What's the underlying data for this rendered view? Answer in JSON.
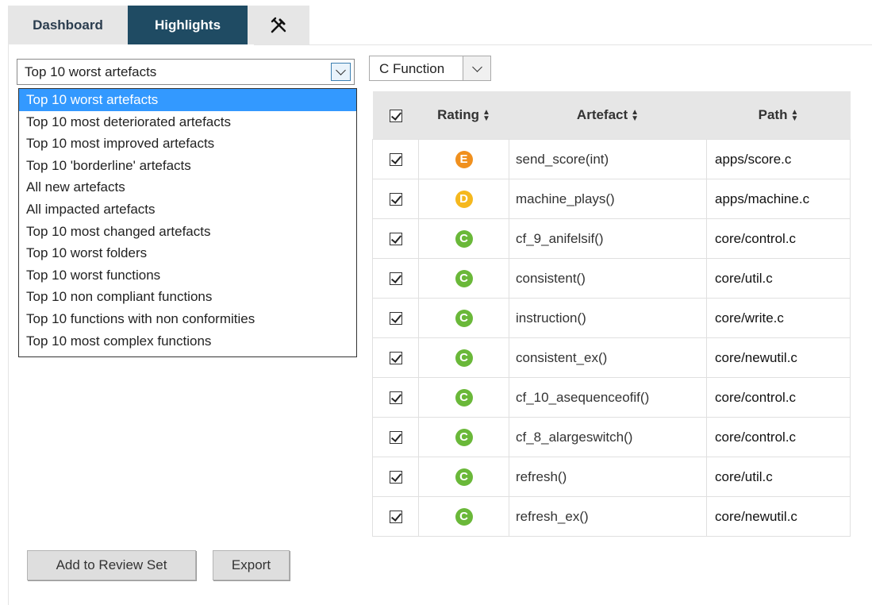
{
  "tabs": {
    "dashboard": "Dashboard",
    "highlights": "Highlights",
    "tools_icon": "✕"
  },
  "highlight_select": {
    "value": "Top 10 worst artefacts",
    "options": [
      "Top 10 worst artefacts",
      "Top 10 most deteriorated artefacts",
      "Top 10 most improved artefacts",
      "Top 10 'borderline' artefacts",
      "All new artefacts",
      "All impacted artefacts",
      "Top 10 most changed artefacts",
      "Top 10 worst folders",
      "Top 10 worst functions",
      "Top 10 non compliant functions",
      "Top 10 functions with non conformities",
      "Top 10 most complex functions"
    ],
    "selected_index": 0
  },
  "type_select": {
    "value": "C Function"
  },
  "table": {
    "headers": {
      "rating": "Rating",
      "artefact": "Artefact",
      "path": "Path"
    },
    "rows": [
      {
        "rating": "E",
        "rating_color": "#f0901e",
        "artefact": "send_score(int)",
        "path": "apps/score.c"
      },
      {
        "rating": "D",
        "rating_color": "#f5b81e",
        "artefact": "machine_plays()",
        "path": "apps/machine.c"
      },
      {
        "rating": "C",
        "rating_color": "#6ab839",
        "artefact": "cf_9_anifelsif()",
        "path": "core/control.c"
      },
      {
        "rating": "C",
        "rating_color": "#6ab839",
        "artefact": "consistent()",
        "path": "core/util.c"
      },
      {
        "rating": "C",
        "rating_color": "#6ab839",
        "artefact": "instruction()",
        "path": "core/write.c"
      },
      {
        "rating": "C",
        "rating_color": "#6ab839",
        "artefact": "consistent_ex()",
        "path": "core/newutil.c"
      },
      {
        "rating": "C",
        "rating_color": "#6ab839",
        "artefact": "cf_10_asequenceofif()",
        "path": "core/control.c"
      },
      {
        "rating": "C",
        "rating_color": "#6ab839",
        "artefact": "cf_8_alargeswitch()",
        "path": "core/control.c"
      },
      {
        "rating": "C",
        "rating_color": "#6ab839",
        "artefact": "refresh()",
        "path": "core/util.c"
      },
      {
        "rating": "C",
        "rating_color": "#6ab839",
        "artefact": "refresh_ex()",
        "path": "core/newutil.c"
      }
    ]
  },
  "buttons": {
    "add_review": "Add to Review Set",
    "export": "Export"
  }
}
